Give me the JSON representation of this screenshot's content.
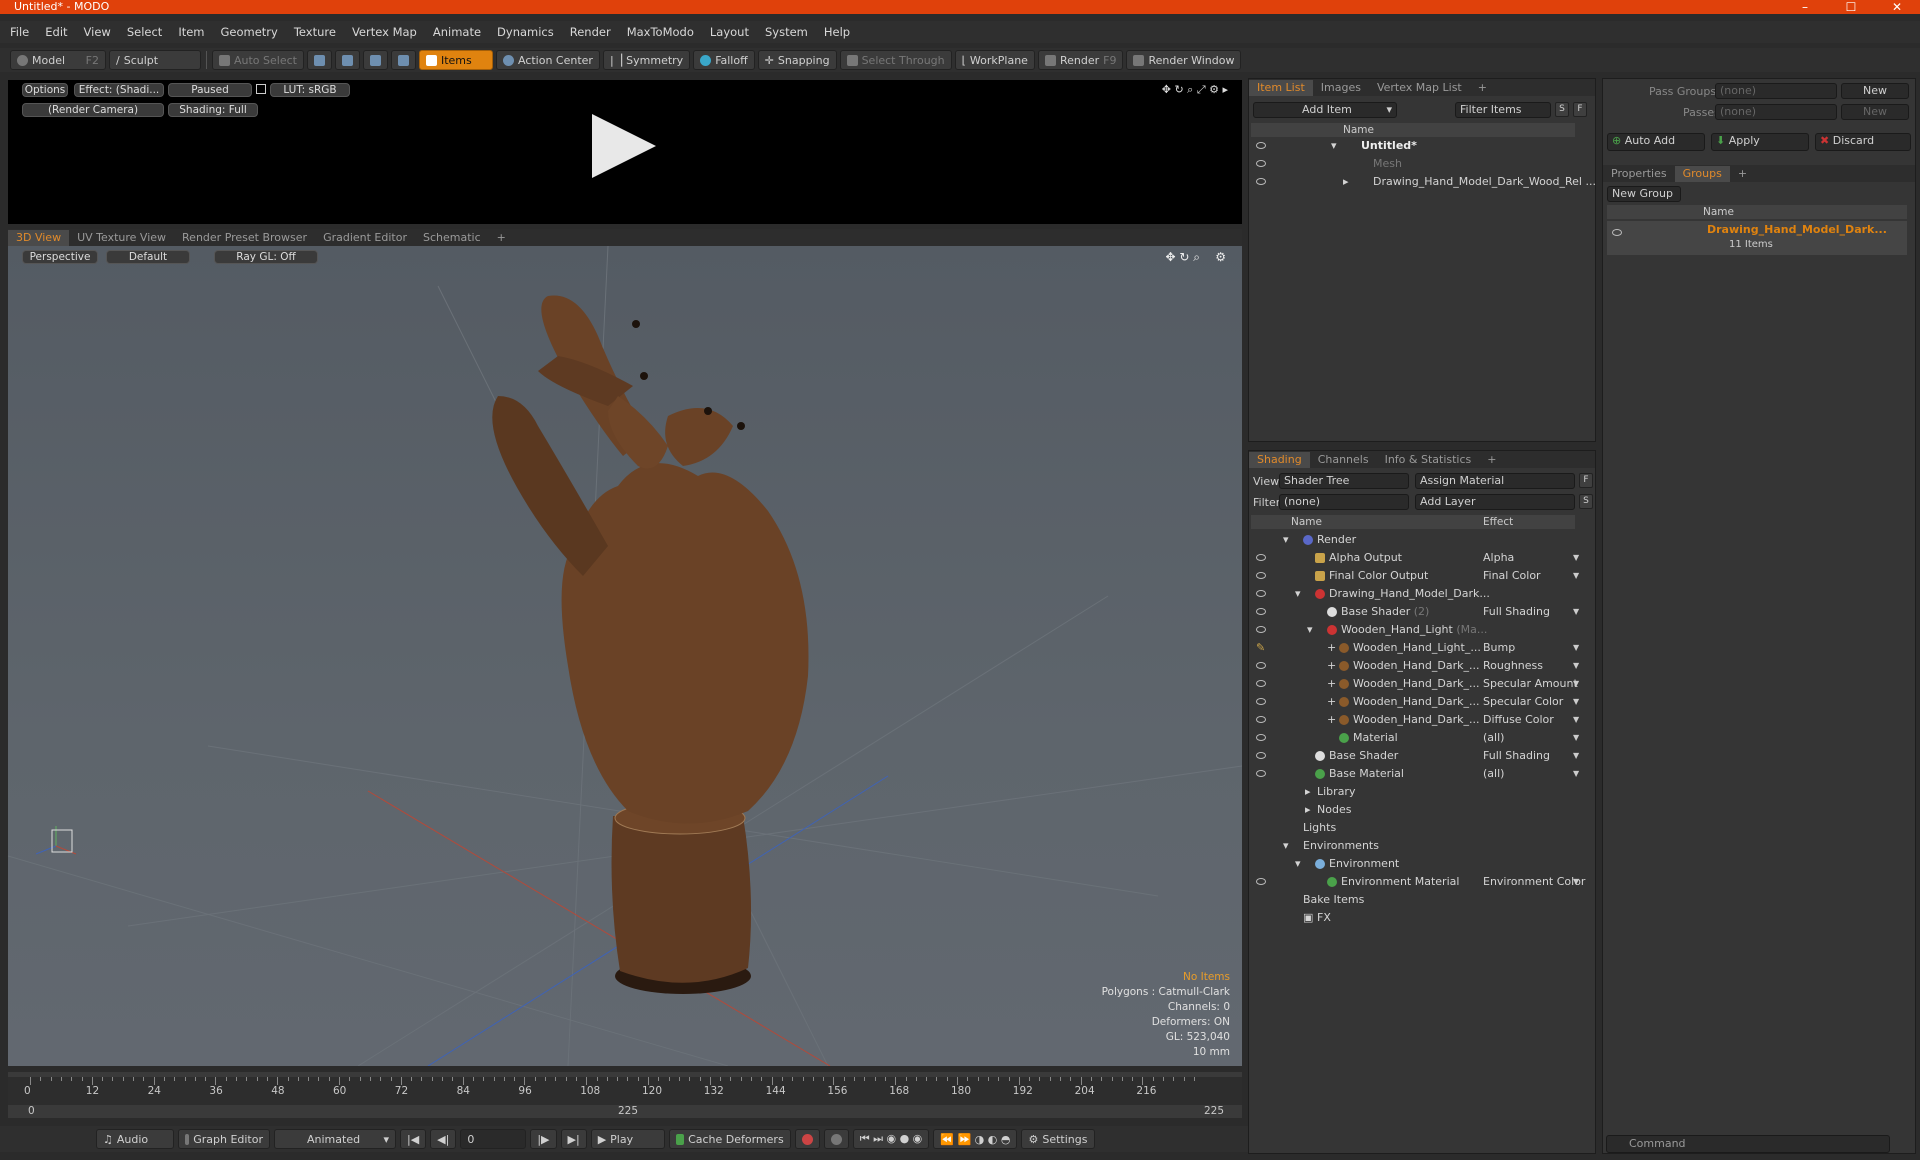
{
  "window": {
    "title": "Untitled* - MODO",
    "controls": [
      "–",
      "☐",
      "✕"
    ]
  },
  "menu": [
    "File",
    "Edit",
    "View",
    "Select",
    "Item",
    "Geometry",
    "Texture",
    "Vertex Map",
    "Animate",
    "Dynamics",
    "Render",
    "MaxToModo",
    "Layout",
    "System",
    "Help"
  ],
  "toolbar": {
    "model": "Model",
    "model_key": "F2",
    "sculpt": "Sculpt",
    "auto_select": "Auto Select",
    "items": "Items",
    "action_center": "Action Center",
    "symmetry": "Symmetry",
    "falloff": "Falloff",
    "snapping": "Snapping",
    "select_through": "Select Through",
    "workplane": "WorkPlane",
    "render": "Render",
    "render_key": "F9",
    "render_window": "Render Window"
  },
  "preview": {
    "options": "Options",
    "effect": "Effect: (Shadi...",
    "paused": "Paused",
    "lut": "LUT: sRGB",
    "camera": "(Render Camera)",
    "shading": "Shading: Full"
  },
  "view_tabs": [
    "3D View",
    "UV Texture View",
    "Render Preset Browser",
    "Gradient Editor",
    "Schematic",
    "+"
  ],
  "viewport": {
    "perspective": "Perspective",
    "default": "Default",
    "raygl": "Ray GL: Off",
    "hud": {
      "items": "No Items",
      "polygons": "Polygons : Catmull-Clark",
      "channels": "Channels: 0",
      "deformers": "Deformers: ON",
      "gl": "GL: 523,040",
      "scale": "10 mm"
    }
  },
  "timeline": {
    "ticks": [
      "0",
      "12",
      "24",
      "36",
      "48",
      "60",
      "72",
      "84",
      "96",
      "108",
      "120",
      "132",
      "144",
      "156",
      "168",
      "180",
      "192",
      "204",
      "216"
    ],
    "range_start": "0",
    "range_mid": "225",
    "range_end": "225"
  },
  "bottombar": {
    "audio": "Audio",
    "graph_editor": "Graph Editor",
    "animated": "Animated",
    "frame": "0",
    "play": "Play",
    "cache_deformers": "Cache Deformers",
    "settings": "Settings"
  },
  "item_list": {
    "tabs": [
      "Item List",
      "Images",
      "Vertex Map List",
      "+"
    ],
    "add_item": "Add Item",
    "filter_items": "Filter Items",
    "s": "S",
    "f": "F",
    "col_name": "Name",
    "rows": [
      {
        "label": "Untitled*"
      },
      {
        "label": "Mesh"
      },
      {
        "label": "Drawing_Hand_Model_Dark_Wood_Rel ..."
      }
    ]
  },
  "shading": {
    "tabs": [
      "Shading",
      "Channels",
      "Info & Statistics",
      "+"
    ],
    "view_label": "View",
    "view_value": "Shader Tree",
    "assign_material": "Assign Material",
    "f": "F",
    "filter_label": "Filter",
    "filter_value": "(none)",
    "add_layer": "Add Layer",
    "s": "S",
    "col_name": "Name",
    "col_effect": "Effect",
    "rows": [
      {
        "label": "Render",
        "effect": ""
      },
      {
        "label": "Alpha Output",
        "effect": "Alpha"
      },
      {
        "label": "Final Color Output",
        "effect": "Final Color"
      },
      {
        "label": "Drawing_Hand_Model_Dark...",
        "effect": ""
      },
      {
        "label": "Base Shader",
        "suffix": "(2)",
        "effect": "Full Shading"
      },
      {
        "label": "Wooden_Hand_Light",
        "suffix": "(Ma...",
        "effect": ""
      },
      {
        "label": "Wooden_Hand_Light_...",
        "effect": "Bump"
      },
      {
        "label": "Wooden_Hand_Dark_...",
        "effect": "Roughness"
      },
      {
        "label": "Wooden_Hand_Dark_...",
        "effect": "Specular Amount"
      },
      {
        "label": "Wooden_Hand_Dark_...",
        "effect": "Specular Color"
      },
      {
        "label": "Wooden_Hand_Dark_...",
        "effect": "Diffuse Color"
      },
      {
        "label": "Material",
        "effect": "(all)"
      },
      {
        "label": "Base Shader",
        "effect": "Full Shading"
      },
      {
        "label": "Base Material",
        "effect": "(all)"
      },
      {
        "label": "Library",
        "effect": ""
      },
      {
        "label": "Nodes",
        "effect": ""
      },
      {
        "label": "Lights",
        "effect": ""
      },
      {
        "label": "Environments",
        "effect": ""
      },
      {
        "label": "Environment",
        "effect": ""
      },
      {
        "label": "Environment Material",
        "effect": "Environment Color"
      },
      {
        "label": "Bake Items",
        "effect": ""
      },
      {
        "label": "FX",
        "effect": ""
      }
    ]
  },
  "groups_panel": {
    "pass_groups_label": "Pass Groups",
    "pass_groups_value": "(none)",
    "new1": "New",
    "passes_label": "Passes",
    "passes_value": "(none)",
    "new2": "New",
    "auto_add": "Auto Add",
    "apply": "Apply",
    "discard": "Discard",
    "tabs": [
      "Properties",
      "Groups",
      "+"
    ],
    "new_group": "New Group",
    "col_name": "Name",
    "group_name": "Drawing_Hand_Model_Dark...",
    "group_count": "11 Items",
    "command_placeholder": "Command"
  },
  "colors": {
    "accent": "#e0830f",
    "titlebar": "#e0410b",
    "bg": "#2b2b2b"
  }
}
